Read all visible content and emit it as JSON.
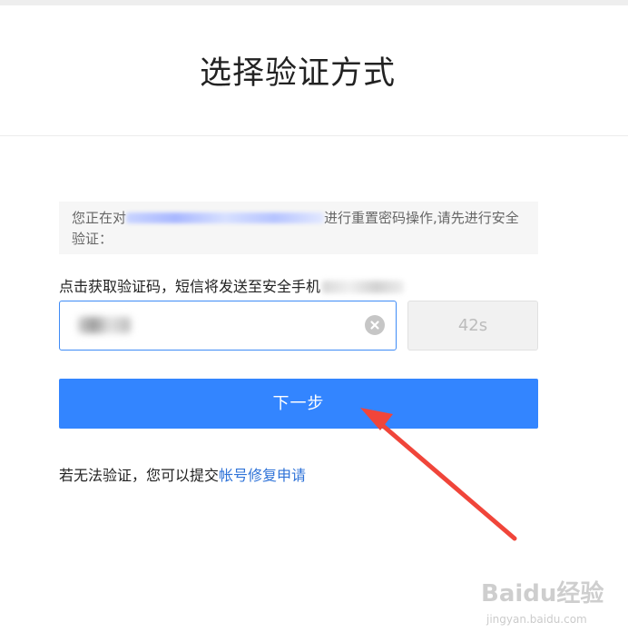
{
  "page": {
    "title": "选择验证方式"
  },
  "notice": {
    "text_before": "您正在对",
    "text_after": "进行重置密码操作,请先进行安全验证："
  },
  "sms": {
    "hint": "点击获取验证码，短信将发送至安全手机"
  },
  "code_input": {
    "value": ""
  },
  "resend_button": {
    "label": "42s"
  },
  "next_button": {
    "label": "下一步"
  },
  "appeal": {
    "text": "若无法验证，您可以提交",
    "link_label": "帐号修复申请"
  },
  "watermark": {
    "logo": "Baidu经验",
    "url": "jingyan.baidu.com"
  },
  "colors": {
    "primary": "#3385ff",
    "link": "#2f73d8",
    "annotation_arrow": "#f0453a"
  }
}
